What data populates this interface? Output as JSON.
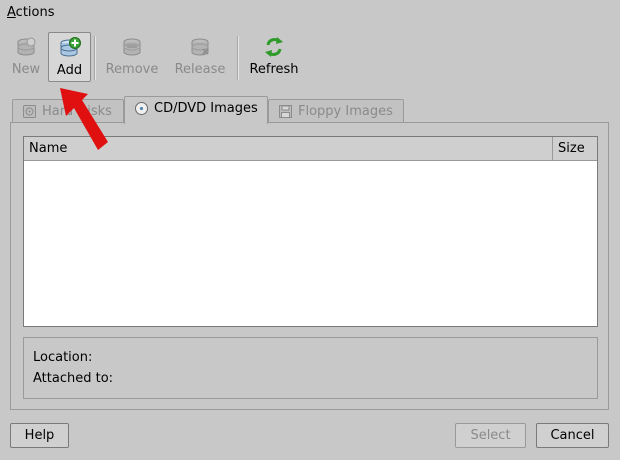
{
  "menu": {
    "actions_label": "Actions"
  },
  "toolbar": {
    "new_label": "New",
    "add_label": "Add",
    "remove_label": "Remove",
    "release_label": "Release",
    "refresh_label": "Refresh"
  },
  "tabs": [
    {
      "label": "Hard Disks",
      "icon": "hard-disk-icon",
      "state": "disabled"
    },
    {
      "label": "CD/DVD Images",
      "icon": "cd-dvd-icon",
      "state": "active"
    },
    {
      "label": "Floppy Images",
      "icon": "floppy-icon",
      "state": "disabled"
    }
  ],
  "list": {
    "columns": [
      "Name",
      "Size"
    ],
    "rows": []
  },
  "info": {
    "location_label": "Location:",
    "attached_label": "Attached to:"
  },
  "buttons": {
    "help": "Help",
    "select": "Select",
    "cancel": "Cancel"
  },
  "annotation": {
    "arrow_color": "#e01010"
  },
  "colors": {
    "window_bg": "#c8c8c8",
    "list_bg": "#ffffff",
    "disabled_text": "#8a8a8a"
  }
}
